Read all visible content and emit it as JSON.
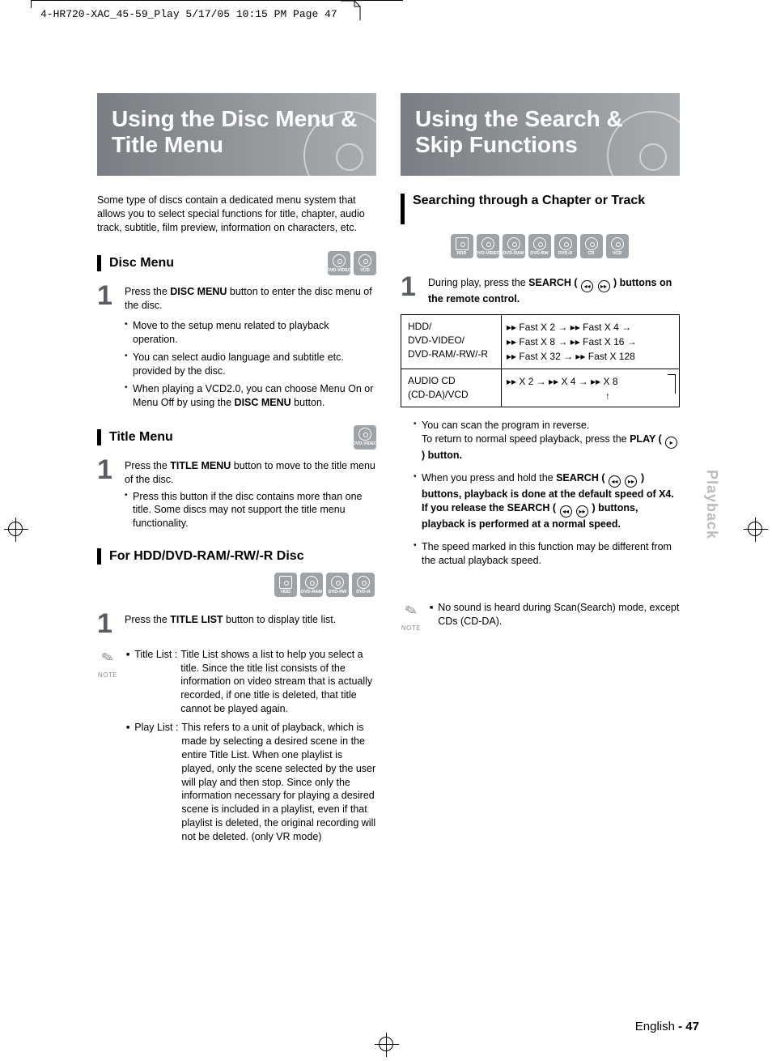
{
  "header": "4-HR720-XAC_45-59_Play  5/17/05  10:15 PM  Page 47",
  "left": {
    "banner": "Using the Disc Menu & Title Menu",
    "intro": "Some type of discs contain a dedicated menu system that allows you to select special functions for title, chapter, audio track, subtitle, film preview, information on characters, etc.",
    "sec1": {
      "title": "Disc Menu",
      "icons": [
        "DVD-VIDEO",
        "VCD"
      ],
      "step1_a": "Press the ",
      "step1_bold": "DISC MENU",
      "step1_b": " button to enter the disc menu of the disc.",
      "bul1": "Move to the setup menu related to playback operation.",
      "bul2": "You can select audio language and subtitle etc. provided by the disc.",
      "bul3_a": "When playing a VCD2.0, you can choose Menu On or Menu Off by using the ",
      "bul3_bold": "DISC MENU",
      "bul3_b": " button."
    },
    "sec2": {
      "title": "Title Menu",
      "icons": [
        "DVD-VIDEO"
      ],
      "step1_a": "Press the ",
      "step1_bold": "TITLE MENU",
      "step1_b": " button to move to the title menu of the disc.",
      "bul1": "Press this button if the disc contains more than one title. Some discs may not support the title menu functionality."
    },
    "sec3": {
      "title": "For HDD/DVD-RAM/-RW/-R Disc",
      "icons": [
        "HDD",
        "DVD-RAM",
        "DVD-RW",
        "DVD-R"
      ],
      "step1_a": "Press the ",
      "step1_bold": "TITLE LIST",
      "step1_b": " button to display title list."
    },
    "note": {
      "item1_label": "Title List :",
      "item1_body": "Title List shows a list to help you select a title. Since the title list consists of the information on video stream that is actually recorded, if one title is deleted, that title cannot be played again.",
      "item2_label": "Play List :",
      "item2_body": "This refers to a unit of playback, which is made by selecting a desired scene in the entire Title List. When one playlist is played, only the scene selected by the user will play and then stop. Since only the information necessary for playing a desired scene is included in a playlist, even if that playlist is deleted, the original recording will not be deleted. (only VR mode)"
    }
  },
  "right": {
    "banner": "Using the Search & Skip Functions",
    "sec1": {
      "title": "Searching through a Chapter or Track",
      "icons": [
        "HDD",
        "DVD-VIDEO",
        "DVD-RAM",
        "DVD-RW",
        "DVD-R",
        "CD",
        "VCD"
      ],
      "step1_a": "During play, press the ",
      "step1_bold": "SEARCH (",
      "step1_b": " ) buttons on the remote control.",
      "table": {
        "r1c1": "HDD/\nDVD-VIDEO/\nDVD-RAM/-RW/-R",
        "r1c2": "▸▸ Fast X 2 → ▸▸ Fast X 4 →\n▸▸ Fast X 8 → ▸▸ Fast X 16 →\n▸▸ Fast X 32 → ▸▸ Fast X 128",
        "r2c1": "AUDIO CD\n(CD-DA)/VCD",
        "r2c2": "▸▸  X 2 → ▸▸  X 4 → ▸▸  X 8"
      },
      "bul1_a": "You can scan the program in reverse.\nTo return to normal speed playback, press the ",
      "bul1_bold": "PLAY (",
      "bul1_b": " ) button.",
      "bul2_a": "When you press and hold the ",
      "bul2_bold": "SEARCH (",
      "bul2_b": " ) buttons, playback is done at the default speed of X4. If you release the ",
      "bul2_bold2": "SEARCH (",
      "bul2_c": " ) buttons, playback is performed at a normal speed.",
      "bul3": "The speed marked in this function may be different from the actual playback speed."
    },
    "note": "No sound is heard during Scan(Search) mode, except CDs (CD-DA)."
  },
  "side_tab": "Playback",
  "note_label": "NOTE",
  "footer_lang": "English",
  "footer_page": "- 47"
}
